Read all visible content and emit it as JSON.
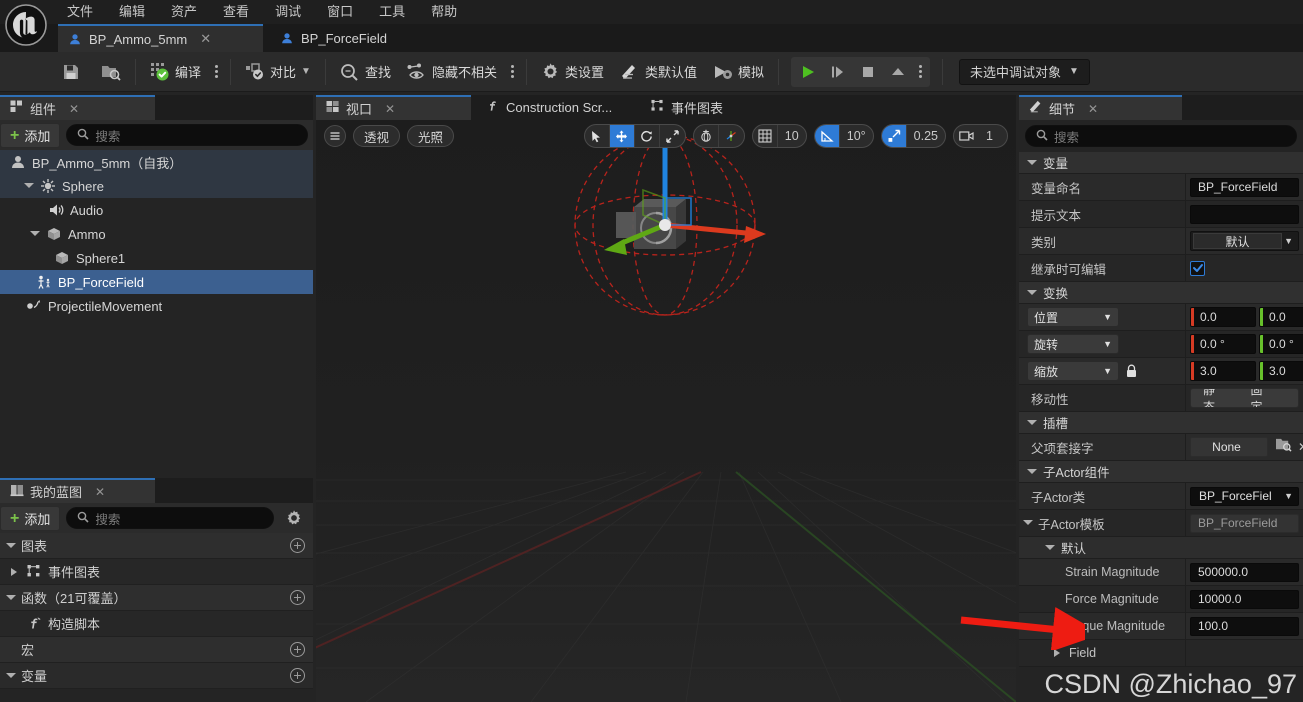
{
  "app": {
    "title": "Unreal Engine Blueprint Editor",
    "logo_icon": "unreal-logo"
  },
  "menubar": {
    "items": [
      {
        "label": "文件"
      },
      {
        "label": "编辑"
      },
      {
        "label": "资产"
      },
      {
        "label": "查看"
      },
      {
        "label": "调试"
      },
      {
        "label": "窗口"
      },
      {
        "label": "工具"
      },
      {
        "label": "帮助"
      }
    ]
  },
  "tabs": [
    {
      "label": "BP_Ammo_5mm",
      "icon": "blueprint-icon",
      "active": true,
      "closable": true
    },
    {
      "label": "BP_ForceField",
      "icon": "blueprint-icon",
      "active": false,
      "closable": false
    }
  ],
  "toolbar": {
    "save_label": "",
    "save_icon": "save-icon",
    "browse_icon": "browse-to-asset-icon",
    "compile_label": "编译",
    "compile_icon": "compile-success-icon",
    "compile_options_icon": "kebab-icon",
    "diff_label": "对比",
    "diff_icon": "diff-icon",
    "find_label": "查找",
    "find_icon": "find-icon",
    "hide_unrelated_label": "隐藏不相关",
    "hide_unrelated_icon": "hide-unrelated-icon",
    "hide_unrelated_options_icon": "kebab-icon",
    "class_settings_label": "类设置",
    "class_settings_icon": "gear-icon",
    "class_defaults_label": "类默认值",
    "class_defaults_icon": "class-defaults-icon",
    "simulate_label": "模拟",
    "simulate_icon": "simulate-icon",
    "play_icon": "play-icon",
    "step_icon": "step-icon",
    "stop_icon": "stop-icon",
    "eject_icon": "eject-icon",
    "play_options_icon": "kebab-icon",
    "debug_target_label": "未选中调试对象",
    "debug_target_caret": "chevron-down-icon"
  },
  "components_panel": {
    "tab_label": "组件",
    "tab_icon": "components-icon",
    "close_icon": "close-icon",
    "add_label": "添加",
    "search_placeholder": "搜索",
    "search_value": "",
    "search_icon": "search-icon",
    "tree": [
      {
        "label": "BP_Ammo_5mm（自我）",
        "icon": "actor-icon",
        "depth": 0,
        "caret": "none",
        "state": "root"
      },
      {
        "label": "Sphere",
        "icon": "sphere-collision-icon",
        "depth": 1,
        "caret": "down",
        "state": "hl"
      },
      {
        "label": "Audio",
        "icon": "audio-icon",
        "depth": 2,
        "caret": "none",
        "state": "normal"
      },
      {
        "label": "Ammo",
        "icon": "mesh-icon",
        "depth": 2,
        "caret": "down",
        "state": "normal"
      },
      {
        "label": "Sphere1",
        "icon": "mesh-icon",
        "depth": 3,
        "caret": "none",
        "state": "normal"
      },
      {
        "label": "BP_ForceField",
        "icon": "child-actor-icon",
        "depth": 2,
        "caret": "none",
        "state": "selected"
      },
      {
        "label": "ProjectileMovement",
        "icon": "projectile-movement-icon",
        "depth": 1,
        "caret": "none",
        "state": "normal"
      }
    ]
  },
  "myblueprint_panel": {
    "tab_label": "我的蓝图",
    "tab_icon": "myblueprint-icon",
    "close_icon": "close-icon",
    "add_label": "添加",
    "search_placeholder": "搜索",
    "search_value": "",
    "search_icon": "search-icon",
    "settings_icon": "gear-icon",
    "rows": [
      {
        "label": "图表",
        "type": "section",
        "caret": "down",
        "add": true,
        "icon": ""
      },
      {
        "label": "事件图表",
        "type": "item",
        "caret": "right",
        "add": false,
        "icon": "event-graph-icon"
      },
      {
        "label": "函数（21可覆盖）",
        "type": "section",
        "caret": "down",
        "add": true,
        "icon": ""
      },
      {
        "label": "构造脚本",
        "type": "item",
        "caret": "none",
        "add": false,
        "icon": "function-icon"
      },
      {
        "label": "宏",
        "type": "section",
        "caret": "none",
        "add": true,
        "icon": ""
      },
      {
        "label": "变量",
        "type": "section",
        "caret": "down",
        "add": true,
        "icon": ""
      }
    ]
  },
  "viewport": {
    "tabs": [
      {
        "label": "视口",
        "icon": "viewport-icon",
        "active": true,
        "closable": true
      },
      {
        "label": "Construction Scr...",
        "icon": "function-icon",
        "active": false,
        "closable": false
      },
      {
        "label": "事件图表",
        "icon": "event-graph-icon",
        "active": false,
        "closable": false
      }
    ],
    "menu_icon": "hamburger-icon",
    "view_mode_label": "透视",
    "lighting_label": "光照",
    "transform_tools": [
      {
        "name": "select-tool",
        "icon": "cursor-icon",
        "active": false
      },
      {
        "name": "translate-tool",
        "icon": "move-icon",
        "active": true
      },
      {
        "name": "rotate-tool",
        "icon": "rotate-icon",
        "active": false
      },
      {
        "name": "scale-tool",
        "icon": "scale-icon",
        "active": false
      }
    ],
    "coord_tools": [
      {
        "name": "world-space-toggle",
        "icon": "globe-icon",
        "active": false
      },
      {
        "name": "surface-snap-toggle",
        "icon": "surface-snap-icon",
        "active": false
      }
    ],
    "grid_snap": {
      "icon": "grid-icon",
      "value": "10",
      "active": false
    },
    "angle_snap": {
      "icon": "angle-icon",
      "value": "10°",
      "active": true
    },
    "scale_snap": {
      "icon": "scale-snap-icon",
      "value": "0.25",
      "active": true
    },
    "camera_speed": {
      "icon": "camera-icon",
      "value": "1",
      "active": false
    }
  },
  "details_panel": {
    "tab_label": "细节",
    "tab_icon": "details-icon",
    "close_icon": "close-icon",
    "search_placeholder": "搜索",
    "search_value": "",
    "search_icon": "search-icon",
    "sections": [
      {
        "title": "变量",
        "rows": [
          {
            "label": "变量命名",
            "kind": "text",
            "value": "BP_ForceField"
          },
          {
            "label": "提示文本",
            "kind": "text",
            "value": ""
          },
          {
            "label": "类别",
            "kind": "combo",
            "value": "默认",
            "caret": "chevron-down-icon"
          },
          {
            "label": "继承时可编辑",
            "kind": "checkbox",
            "value": true
          }
        ]
      },
      {
        "title": "变换",
        "rows": [
          {
            "label": "位置",
            "kind": "vector",
            "mode": "位置",
            "x": "0.0",
            "y": "0.0",
            "z": ""
          },
          {
            "label": "旋转",
            "kind": "vector",
            "mode": "旋转",
            "x": "0.0 °",
            "y": "0.0 °",
            "z": ""
          },
          {
            "label": "缩放",
            "kind": "vector",
            "mode": "缩放",
            "x": "3.0",
            "y": "3.0",
            "z": "",
            "lock_icon": "lock-icon"
          },
          {
            "label": "移动性",
            "kind": "mobility",
            "options": [
              "静态",
              "固定"
            ],
            "selected": ""
          }
        ]
      },
      {
        "title": "插槽",
        "rows": [
          {
            "label": "父项套接字",
            "kind": "socket",
            "value": "None",
            "browse_icon": "browse-icon",
            "clear_icon": "clear-icon"
          }
        ]
      },
      {
        "title": "子Actor组件",
        "rows": [
          {
            "label": "子Actor类",
            "kind": "combo",
            "value": "BP_ForceFiel",
            "caret": "chevron-down-icon"
          },
          {
            "label": "子Actor模板",
            "kind": "subsection",
            "value": "BP_ForceField",
            "caret": "down"
          }
        ]
      },
      {
        "title": "默认",
        "indent": true,
        "rows": [
          {
            "label": "Strain Magnitude",
            "kind": "text",
            "value": "500000.0"
          },
          {
            "label": "Force Magnitude",
            "kind": "text",
            "value": "10000.0"
          },
          {
            "label": "Torque Magnitude",
            "kind": "text",
            "value": "100.0"
          },
          {
            "label": "Field",
            "kind": "collapsed",
            "caret": "right"
          }
        ]
      }
    ]
  },
  "annotation": {
    "arrow_color": "#ee1c12",
    "arrow_target": "Force Magnitude"
  },
  "watermark": {
    "text": "CSDN @Zhichao_97"
  },
  "colors": {
    "accent_blue": "#2e7bd6",
    "selection_blue": "#3c6090",
    "compile_green": "#5cc03c",
    "add_green": "#7cc24a",
    "panel_bg": "#242424",
    "toolbar_bg": "#2b2b2b",
    "axis_x_red": "#e03a28",
    "axis_y_green": "#5dc22b",
    "axis_z_blue": "#2e8be0"
  }
}
